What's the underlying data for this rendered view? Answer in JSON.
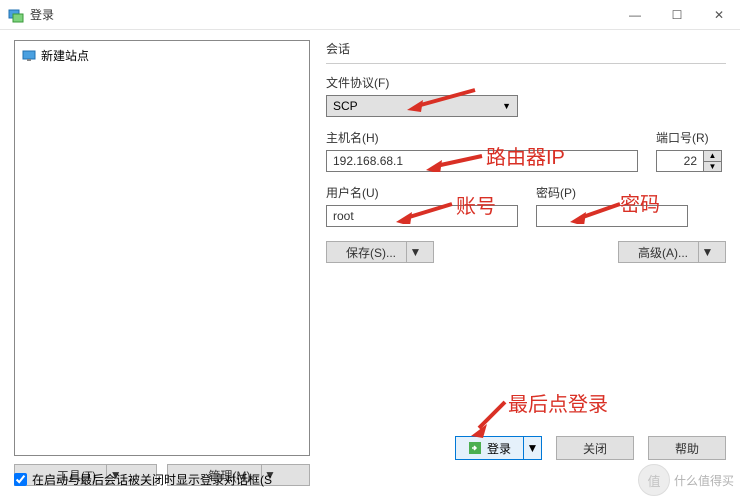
{
  "window": {
    "title": "登录",
    "min": "—",
    "max": "☐",
    "close": "✕"
  },
  "sites": {
    "new_site": "新建站点",
    "tools_btn": "工具(T)",
    "manage_btn": "管理(M)"
  },
  "session": {
    "group": "会话",
    "protocol_label": "文件协议(F)",
    "protocol_value": "SCP",
    "host_label": "主机名(H)",
    "host_value": "192.168.68.1",
    "port_label": "端口号(R)",
    "port_value": "22",
    "user_label": "用户名(U)",
    "user_value": "root",
    "pwd_label": "密码(P)",
    "pwd_value": "",
    "save_btn": "保存(S)...",
    "adv_btn": "高级(A)..."
  },
  "bottom": {
    "login": "登录",
    "close": "关闭",
    "help": "帮助"
  },
  "checkbox": {
    "label": "在启动与最后会话被关闭时显示登录对话框(S"
  },
  "annotations": {
    "router_ip": "路由器IP",
    "account": "账号",
    "password": "密码",
    "click_login": "最后点登录"
  },
  "watermark": "什么值得买"
}
